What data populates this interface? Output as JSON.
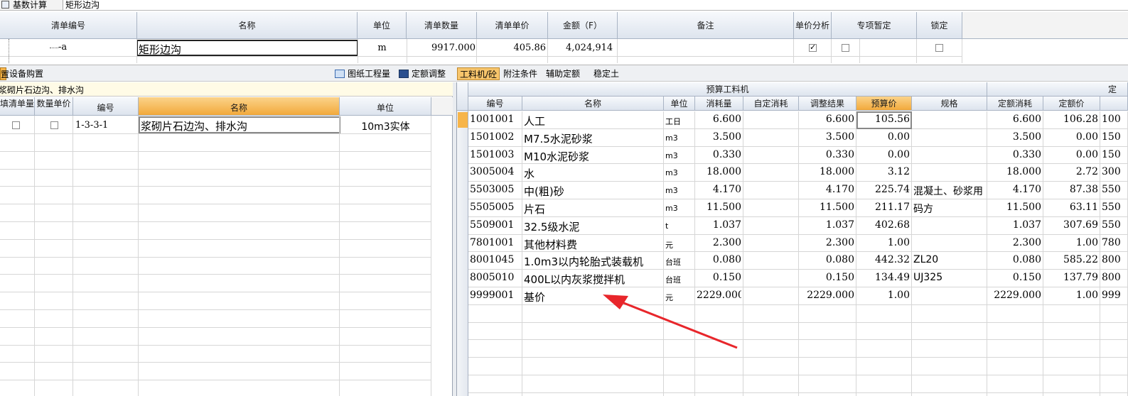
{
  "top_bar": {
    "tab_label": "基数计算",
    "name_value": "矩形边沟"
  },
  "bill": {
    "headers": [
      "清单编号",
      "名称",
      "单位",
      "清单数量",
      "清单单价",
      "金额（F）",
      "备注",
      "单价分析",
      "专项暂定",
      "锁定"
    ],
    "row": {
      "code": "-a",
      "name": "矩形边沟",
      "unit": "m",
      "qty": "9917.000",
      "price": "405.86",
      "amount": "4,024,914"
    }
  },
  "left_toolbar": {
    "tab_a": "置",
    "tab_b": "设备购置"
  },
  "middle_toolbar": {
    "drawing_qty": "图纸工程量",
    "quota_adjust": "定额调整"
  },
  "right_toolbar": {
    "tab_labor": "工料机/砼",
    "tab_attach": "附注条件",
    "tab_aux": "辅助定额",
    "tab_stable": "稳定土"
  },
  "left_panel": {
    "path_label": "浆砌片石边沟、排水沟",
    "headers": [
      "填清单量",
      "数量单价",
      "编号",
      "名称",
      "单位"
    ],
    "row": {
      "code": "1-3-3-1",
      "name": "浆砌片石边沟、排水沟",
      "unit": "10m3实体"
    }
  },
  "right_panel": {
    "group_header": "预算工料机",
    "group_header_right": "定",
    "headers": [
      "编号",
      "名称",
      "单位",
      "消耗量",
      "自定消耗",
      "调整结果",
      "预算价",
      "规格",
      "定额消耗",
      "定额价"
    ],
    "rows": [
      {
        "code": "1001001",
        "name": "人工",
        "unit": "工日",
        "cons": "6.600",
        "adj": "6.600",
        "price": "105.56",
        "spec": "",
        "qcons": "6.600",
        "qprice": "106.28",
        "extra": "100"
      },
      {
        "code": "1501002",
        "name": "M7.5水泥砂浆",
        "unit": "m3",
        "cons": "3.500",
        "adj": "3.500",
        "price": "0.00",
        "spec": "",
        "qcons": "3.500",
        "qprice": "0.00",
        "extra": "150"
      },
      {
        "code": "1501003",
        "name": "M10水泥砂浆",
        "unit": "m3",
        "cons": "0.330",
        "adj": "0.330",
        "price": "0.00",
        "spec": "",
        "qcons": "0.330",
        "qprice": "0.00",
        "extra": "150"
      },
      {
        "code": "3005004",
        "name": "水",
        "unit": "m3",
        "cons": "18.000",
        "adj": "18.000",
        "price": "3.12",
        "spec": "",
        "qcons": "18.000",
        "qprice": "2.72",
        "extra": "300"
      },
      {
        "code": "5503005",
        "name": "中(粗)砂",
        "unit": "m3",
        "cons": "4.170",
        "adj": "4.170",
        "price": "225.74",
        "spec": "混凝土、砂浆用",
        "qcons": "4.170",
        "qprice": "87.38",
        "extra": "550"
      },
      {
        "code": "5505005",
        "name": "片石",
        "unit": "m3",
        "cons": "11.500",
        "adj": "11.500",
        "price": "211.17",
        "spec": "码方",
        "qcons": "11.500",
        "qprice": "63.11",
        "extra": "550"
      },
      {
        "code": "5509001",
        "name": "32.5级水泥",
        "unit": "t",
        "cons": "1.037",
        "adj": "1.037",
        "price": "402.68",
        "spec": "",
        "qcons": "1.037",
        "qprice": "307.69",
        "extra": "550"
      },
      {
        "code": "7801001",
        "name": "其他材料费",
        "unit": "元",
        "cons": "2.300",
        "adj": "2.300",
        "price": "1.00",
        "spec": "",
        "qcons": "2.300",
        "qprice": "1.00",
        "extra": "780"
      },
      {
        "code": "8001045",
        "name": "1.0m3以内轮胎式装载机",
        "unit": "台班",
        "cons": "0.080",
        "adj": "0.080",
        "price": "442.32",
        "spec": "ZL20",
        "qcons": "0.080",
        "qprice": "585.22",
        "extra": "800"
      },
      {
        "code": "8005010",
        "name": "400L以内灰浆搅拌机",
        "unit": "台班",
        "cons": "0.150",
        "adj": "0.150",
        "price": "134.49",
        "spec": "UJ325",
        "qcons": "0.150",
        "qprice": "137.79",
        "extra": "800"
      },
      {
        "code": "9999001",
        "name": "基价",
        "unit": "元",
        "cons": "2229.000",
        "adj": "2229.000",
        "price": "1.00",
        "spec": "",
        "qcons": "2229.000",
        "qprice": "1.00",
        "extra": "999"
      }
    ]
  },
  "colors": {
    "accent_orange": "#f7b54a",
    "arrow_red": "#e8262b",
    "header_bg": "#dde4ee"
  }
}
